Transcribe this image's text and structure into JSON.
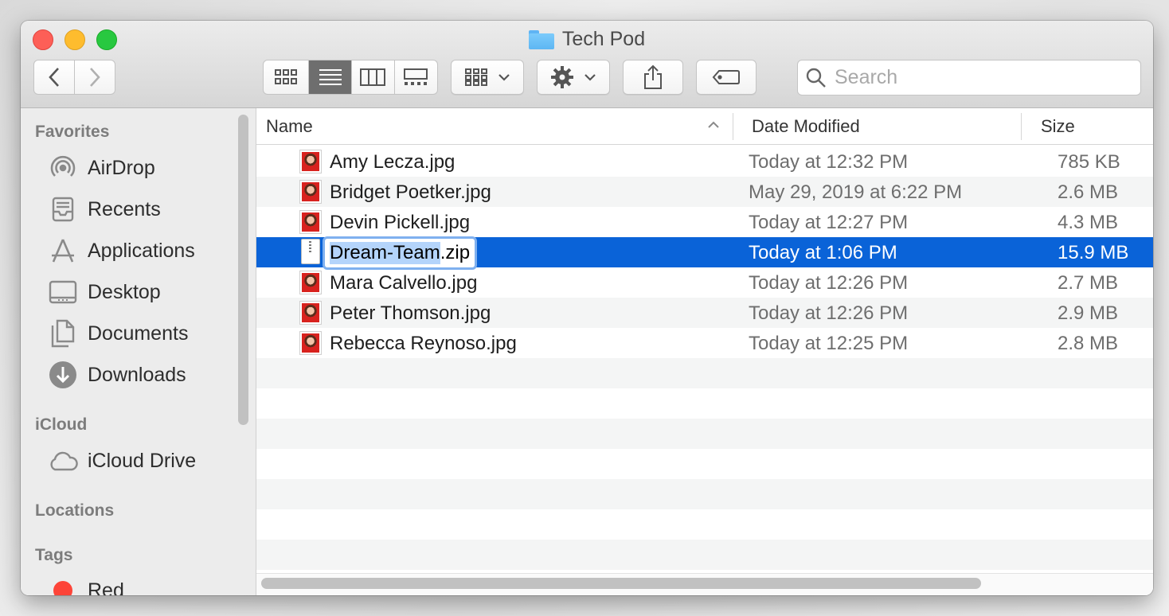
{
  "window": {
    "title": "Tech Pod"
  },
  "toolbar": {
    "back": "back",
    "forward": "forward",
    "view_modes": [
      "icon-view",
      "list-view",
      "column-view",
      "gallery-view"
    ],
    "active_view": "list-view",
    "search": {
      "placeholder": "Search",
      "value": ""
    }
  },
  "sidebar": {
    "favorites_header": "Favorites",
    "favorites": [
      {
        "label": "AirDrop",
        "icon": "airdrop-icon"
      },
      {
        "label": "Recents",
        "icon": "recents-icon"
      },
      {
        "label": "Applications",
        "icon": "applications-icon"
      },
      {
        "label": "Desktop",
        "icon": "desktop-icon"
      },
      {
        "label": "Documents",
        "icon": "documents-icon"
      },
      {
        "label": "Downloads",
        "icon": "downloads-icon"
      }
    ],
    "icloud_header": "iCloud",
    "icloud": [
      {
        "label": "iCloud Drive",
        "icon": "cloud-icon"
      }
    ],
    "locations_header": "Locations",
    "tags_header": "Tags",
    "tags": [
      {
        "label": "Red",
        "color": "#fd4438"
      }
    ]
  },
  "list": {
    "columns": {
      "name": "Name",
      "date": "Date Modified",
      "size": "Size"
    },
    "sort": "name-ascending",
    "files": [
      {
        "name": "Amy Lecza.jpg",
        "date": "Today at 12:32 PM",
        "size": "785 KB",
        "type": "image"
      },
      {
        "name": "Bridget Poetker.jpg",
        "date": "May 29, 2019 at 6:22 PM",
        "size": "2.6 MB",
        "type": "image"
      },
      {
        "name": "Devin Pickell.jpg",
        "date": "Today at 12:27 PM",
        "size": "4.3 MB",
        "type": "image"
      },
      {
        "name": "Dream-Team.zip",
        "name_selected": "Dream-Team",
        "name_ext": ".zip",
        "date": "Today at 1:06 PM",
        "size": "15.9 MB",
        "type": "zip",
        "selected": true,
        "renaming": true
      },
      {
        "name": "Mara Calvello.jpg",
        "date": "Today at 12:26 PM",
        "size": "2.7 MB",
        "type": "image"
      },
      {
        "name": "Peter Thomson.jpg",
        "date": "Today at 12:26 PM",
        "size": "2.9 MB",
        "type": "image"
      },
      {
        "name": "Rebecca Reynoso.jpg",
        "date": "Today at 12:25 PM",
        "size": "2.8 MB",
        "type": "image"
      }
    ]
  },
  "colors": {
    "selection": "#0a63d8",
    "rename_highlight": "#b4d4fb"
  }
}
